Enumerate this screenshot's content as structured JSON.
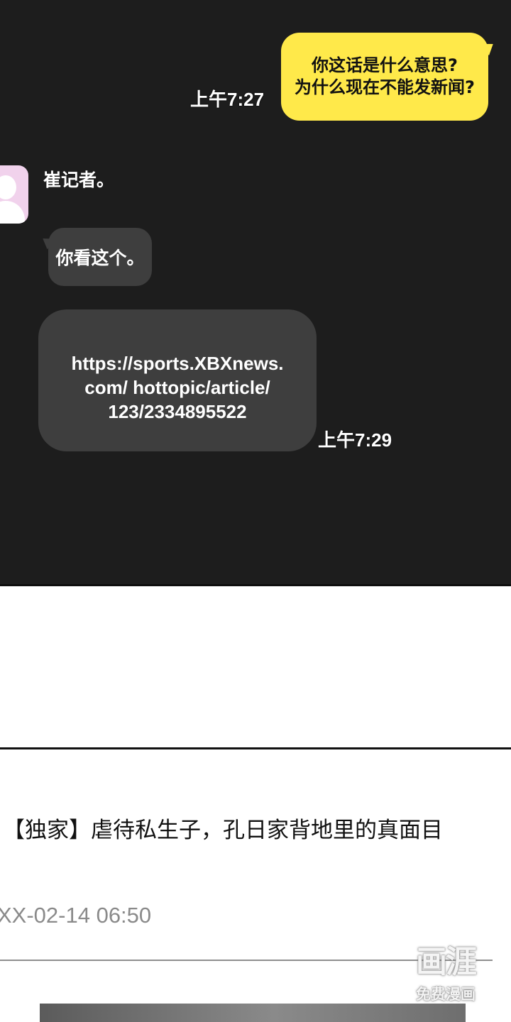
{
  "chat": {
    "outgoing": {
      "lines": [
        "你这话是什么意思?",
        "为什么现在不能发新闻?"
      ],
      "time": "上午7:27"
    },
    "incoming": {
      "sender": "崔记者。",
      "message": "你看这个。",
      "link_lines": [
        "https://sports.XBXnews.",
        "com/ hottopic/article/",
        "123/2334895522"
      ],
      "time": "上午7:29"
    },
    "colors": {
      "panel_bg": "#1d1d1d",
      "outgoing_bubble": "#ffe94a",
      "incoming_bubble": "#3e3e3e",
      "avatar_bg": "#f1d2ec"
    }
  },
  "article": {
    "headline": "【独家】虐待私生子，孔日家背地里的真面目",
    "date": "XX-02-14 06:50"
  },
  "watermark": {
    "logo": "画涯",
    "sub": "免费漫画"
  },
  "icons": {
    "avatar": "person-silhouette-icon"
  }
}
